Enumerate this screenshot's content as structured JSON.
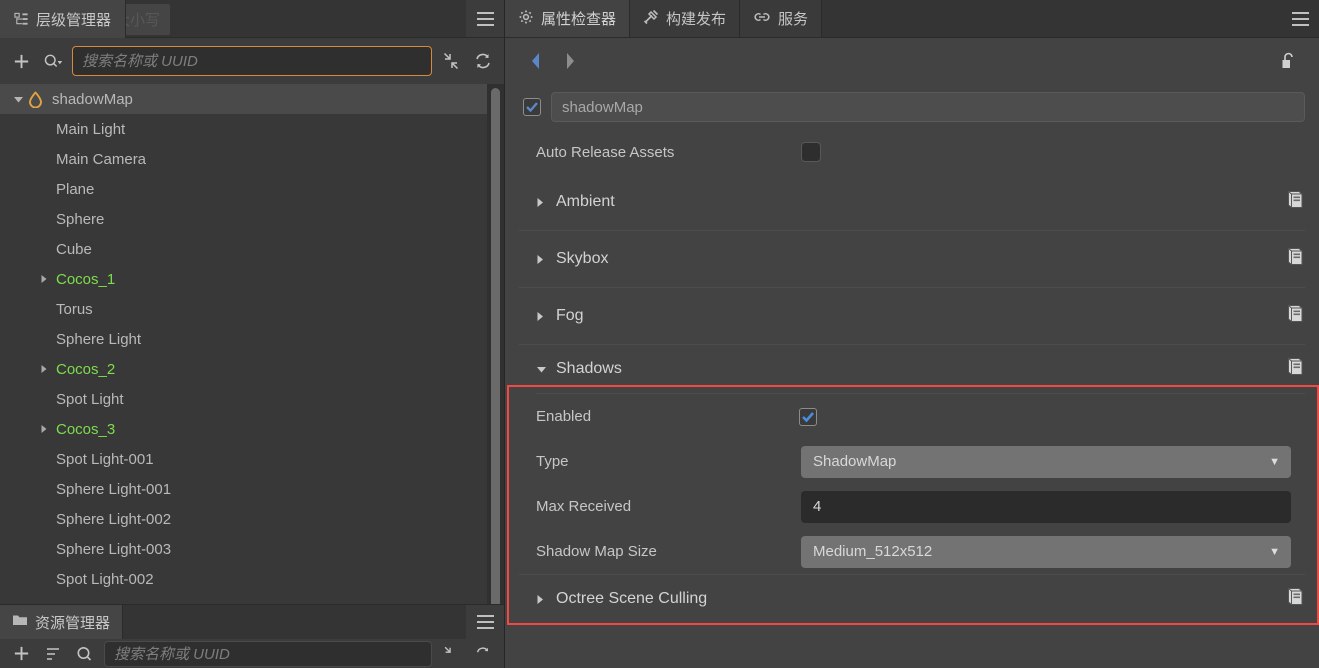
{
  "hierarchy_panel": {
    "tab_label": "层级管理器",
    "tab_icon": "hierarchy-icon",
    "tooltip_ghost": "搜索名称不区分大小写",
    "menu_icon": "hamburger-menu-icon",
    "toolbar": {
      "add_label": "+",
      "search_dropdown_icon": "search-dropdown-icon",
      "collapse_all_icon": "collapse-all-icon",
      "refresh_icon": "refresh-icon"
    },
    "search": {
      "placeholder": "搜索名称或 UUID",
      "value": ""
    },
    "tree": [
      {
        "label": "shadowMap",
        "depth": 0,
        "expanded": true,
        "has_children": true,
        "selected": true,
        "prefab": false,
        "icon": "scene-flame-icon"
      },
      {
        "label": "Main Light",
        "depth": 1,
        "expanded": false,
        "has_children": false,
        "selected": false,
        "prefab": false
      },
      {
        "label": "Main Camera",
        "depth": 1,
        "expanded": false,
        "has_children": false,
        "selected": false,
        "prefab": false
      },
      {
        "label": "Plane",
        "depth": 1,
        "expanded": false,
        "has_children": false,
        "selected": false,
        "prefab": false
      },
      {
        "label": "Sphere",
        "depth": 1,
        "expanded": false,
        "has_children": false,
        "selected": false,
        "prefab": false
      },
      {
        "label": "Cube",
        "depth": 1,
        "expanded": false,
        "has_children": false,
        "selected": false,
        "prefab": false
      },
      {
        "label": "Cocos_1",
        "depth": 1,
        "expanded": false,
        "has_children": true,
        "selected": false,
        "prefab": true
      },
      {
        "label": "Torus",
        "depth": 1,
        "expanded": false,
        "has_children": false,
        "selected": false,
        "prefab": false
      },
      {
        "label": "Sphere Light",
        "depth": 1,
        "expanded": false,
        "has_children": false,
        "selected": false,
        "prefab": false
      },
      {
        "label": "Cocos_2",
        "depth": 1,
        "expanded": false,
        "has_children": true,
        "selected": false,
        "prefab": true
      },
      {
        "label": "Spot Light",
        "depth": 1,
        "expanded": false,
        "has_children": false,
        "selected": false,
        "prefab": false
      },
      {
        "label": "Cocos_3",
        "depth": 1,
        "expanded": false,
        "has_children": true,
        "selected": false,
        "prefab": true
      },
      {
        "label": "Spot Light-001",
        "depth": 1,
        "expanded": false,
        "has_children": false,
        "selected": false,
        "prefab": false
      },
      {
        "label": "Sphere Light-001",
        "depth": 1,
        "expanded": false,
        "has_children": false,
        "selected": false,
        "prefab": false
      },
      {
        "label": "Sphere Light-002",
        "depth": 1,
        "expanded": false,
        "has_children": false,
        "selected": false,
        "prefab": false
      },
      {
        "label": "Sphere Light-003",
        "depth": 1,
        "expanded": false,
        "has_children": false,
        "selected": false,
        "prefab": false
      },
      {
        "label": "Spot Light-002",
        "depth": 1,
        "expanded": false,
        "has_children": false,
        "selected": false,
        "prefab": false
      }
    ]
  },
  "assets_panel": {
    "tab_label": "资源管理器",
    "tab_icon": "folder-icon",
    "menu_icon": "hamburger-menu-icon",
    "search_placeholder": "搜索名称或 UUID",
    "add_label": "+"
  },
  "inspector": {
    "tabs": [
      {
        "label": "属性检查器",
        "icon": "gear-icon",
        "active": true
      },
      {
        "label": "构建发布",
        "icon": "hammer-icon",
        "active": false
      },
      {
        "label": "服务",
        "icon": "link-icon",
        "active": false
      }
    ],
    "menu_icon": "hamburger-menu-icon",
    "nav": {
      "back_icon": "back-arrow-icon",
      "forward_icon": "forward-arrow-icon",
      "lock_icon": "unlock-icon"
    },
    "node": {
      "enabled": true,
      "name": "shadowMap"
    },
    "auto_release": {
      "label": "Auto Release Assets",
      "value": false
    },
    "sections": [
      {
        "label": "Ambient",
        "expanded": false,
        "help_icon": "book-icon"
      },
      {
        "label": "Skybox",
        "expanded": false,
        "help_icon": "book-icon"
      },
      {
        "label": "Fog",
        "expanded": false,
        "help_icon": "book-icon"
      },
      {
        "label": "Shadows",
        "expanded": true,
        "help_icon": "book-icon",
        "highlighted": true
      },
      {
        "label": "Octree Scene Culling",
        "expanded": false,
        "help_icon": "book-icon"
      }
    ],
    "shadows": {
      "title": "Shadows",
      "enabled_label": "Enabled",
      "enabled_value": true,
      "type_label": "Type",
      "type_value": "ShadowMap",
      "max_received_label": "Max Received",
      "max_received_value": "4",
      "shadow_map_size_label": "Shadow Map Size",
      "shadow_map_size_value": "Medium_512x512"
    }
  },
  "colors": {
    "highlight_border": "#f04a43",
    "prefab_text": "#7ddd4a",
    "accent_blue": "#4a8ddc",
    "search_focus": "#d68a3a",
    "scene_icon": "#e0a243"
  }
}
